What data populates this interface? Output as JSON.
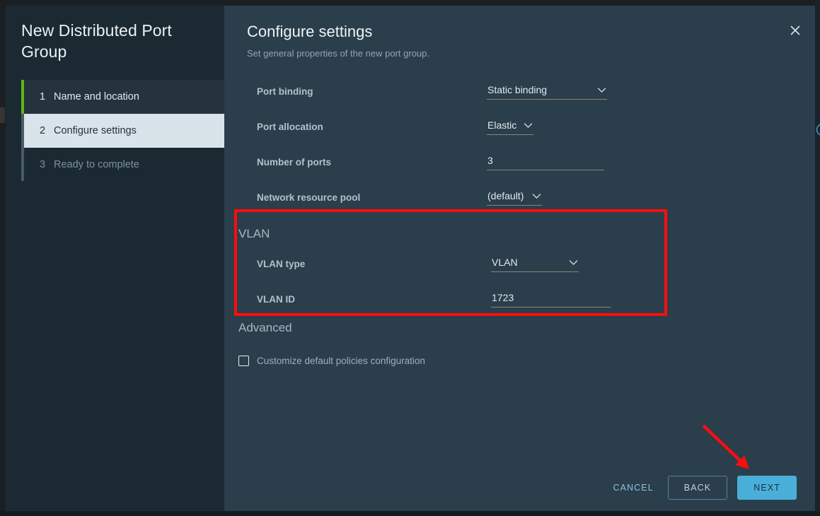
{
  "wizard": {
    "title": "New Distributed Port Group",
    "steps": [
      {
        "num": "1",
        "label": "Name and location",
        "state": "done"
      },
      {
        "num": "2",
        "label": "Configure settings",
        "state": "active"
      },
      {
        "num": "3",
        "label": "Ready to complete",
        "state": "pending"
      }
    ]
  },
  "panel": {
    "title": "Configure settings",
    "subtitle": "Set general properties of the new port group.",
    "close_icon": "close-icon"
  },
  "form": {
    "port_binding": {
      "label": "Port binding",
      "value": "Static binding",
      "chevron": "chevron-down-icon"
    },
    "port_allocation": {
      "label": "Port allocation",
      "value": "Elastic",
      "chevron": "chevron-down-icon",
      "info_icon": "info-icon"
    },
    "number_of_ports": {
      "label": "Number of ports",
      "value": "3"
    },
    "network_resource_pool": {
      "label": "Network resource pool",
      "value": "(default)",
      "chevron": "chevron-down-icon"
    }
  },
  "vlan": {
    "heading": "VLAN",
    "vlan_type": {
      "label": "VLAN type",
      "value": "VLAN",
      "chevron": "chevron-down-icon"
    },
    "vlan_id": {
      "label": "VLAN ID",
      "value": "1723"
    }
  },
  "advanced": {
    "heading": "Advanced",
    "customize_checkbox": {
      "label": "Customize default policies configuration",
      "checked": false
    }
  },
  "footer": {
    "cancel": "CANCEL",
    "back": "BACK",
    "next": "NEXT"
  },
  "colors": {
    "accent_blue": "#49afd9",
    "step_done_green": "#60b515",
    "annotation_red": "#fb0d0d",
    "sidebar_bg": "#1b2a32",
    "panel_bg": "#2a3e4c",
    "underline": "#8d8573"
  }
}
